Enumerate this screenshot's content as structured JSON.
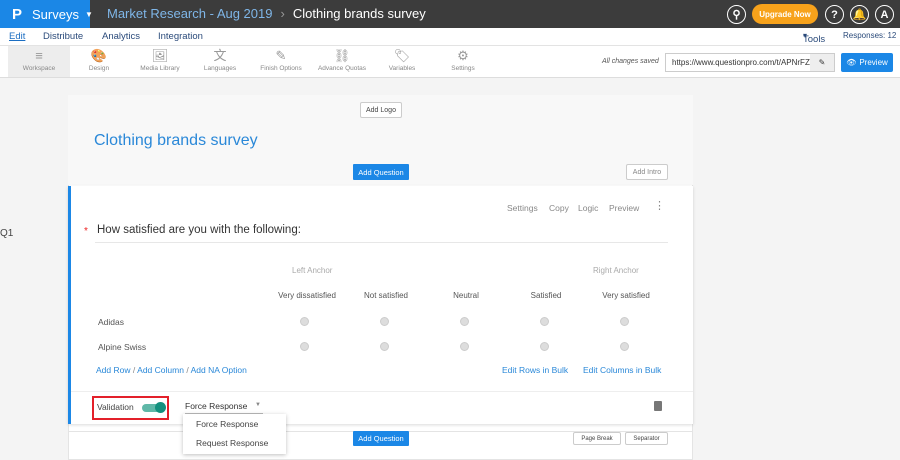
{
  "header": {
    "brand": "Surveys",
    "logo": "P",
    "breadcrumb_parent": "Market Research - Aug 2019",
    "breadcrumb_current": "Clothing brands survey",
    "upgrade": "Upgrade Now",
    "search_icon": "search-icon",
    "help": "?",
    "bell_icon": "bell-icon",
    "avatar": "A",
    "brand_color": "#1b87e6",
    "upgrade_color": "#f7a21b"
  },
  "nav": {
    "tabs": [
      "Edit",
      "Distribute",
      "Analytics",
      "Integration"
    ],
    "active": "Edit",
    "tools": "Tools",
    "responses": "Responses: 12"
  },
  "toolbar": {
    "items": [
      {
        "label": "Workspace",
        "icon": "≡"
      },
      {
        "label": "Design",
        "icon": "🎨"
      },
      {
        "label": "Media Library",
        "icon": "🖼"
      },
      {
        "label": "Languages",
        "icon": "文"
      },
      {
        "label": "Finish Options",
        "icon": "✎"
      },
      {
        "label": "Advance Quotas",
        "icon": "⛓"
      },
      {
        "label": "Variables",
        "icon": "🏷"
      },
      {
        "label": "Settings",
        "icon": "⚙"
      }
    ],
    "saved": "All changes saved",
    "url": "https://www.questionpro.com/t/APNrFZ",
    "preview": "Preview"
  },
  "survey": {
    "add_logo": "Add Logo",
    "title": "Clothing brands survey",
    "add_question": "Add Question",
    "add_intro": "Add Intro",
    "page_break": "Page Break",
    "separator": "Separator"
  },
  "question": {
    "number": "Q1",
    "text": "How satisfied are you with the following:",
    "actions": [
      "Settings",
      "Copy",
      "Logic",
      "Preview"
    ],
    "left_anchor": "Left Anchor",
    "right_anchor": "Right Anchor",
    "columns": [
      "Very dissatisfied",
      "Not satisfied",
      "Neutral",
      "Satisfied",
      "Very satisfied"
    ],
    "rows": [
      "Adidas",
      "Alpine Swiss"
    ],
    "add_row": "Add Row",
    "add_column": "Add Column",
    "add_na": "Add NA Option",
    "slash": "/",
    "edit_rows": "Edit Rows in Bulk",
    "edit_columns": "Edit Columns in Bulk",
    "validation": "Validation",
    "validation_on": true,
    "validation_type": "Force Response",
    "validation_options": [
      "Force Response",
      "Request Response"
    ]
  }
}
